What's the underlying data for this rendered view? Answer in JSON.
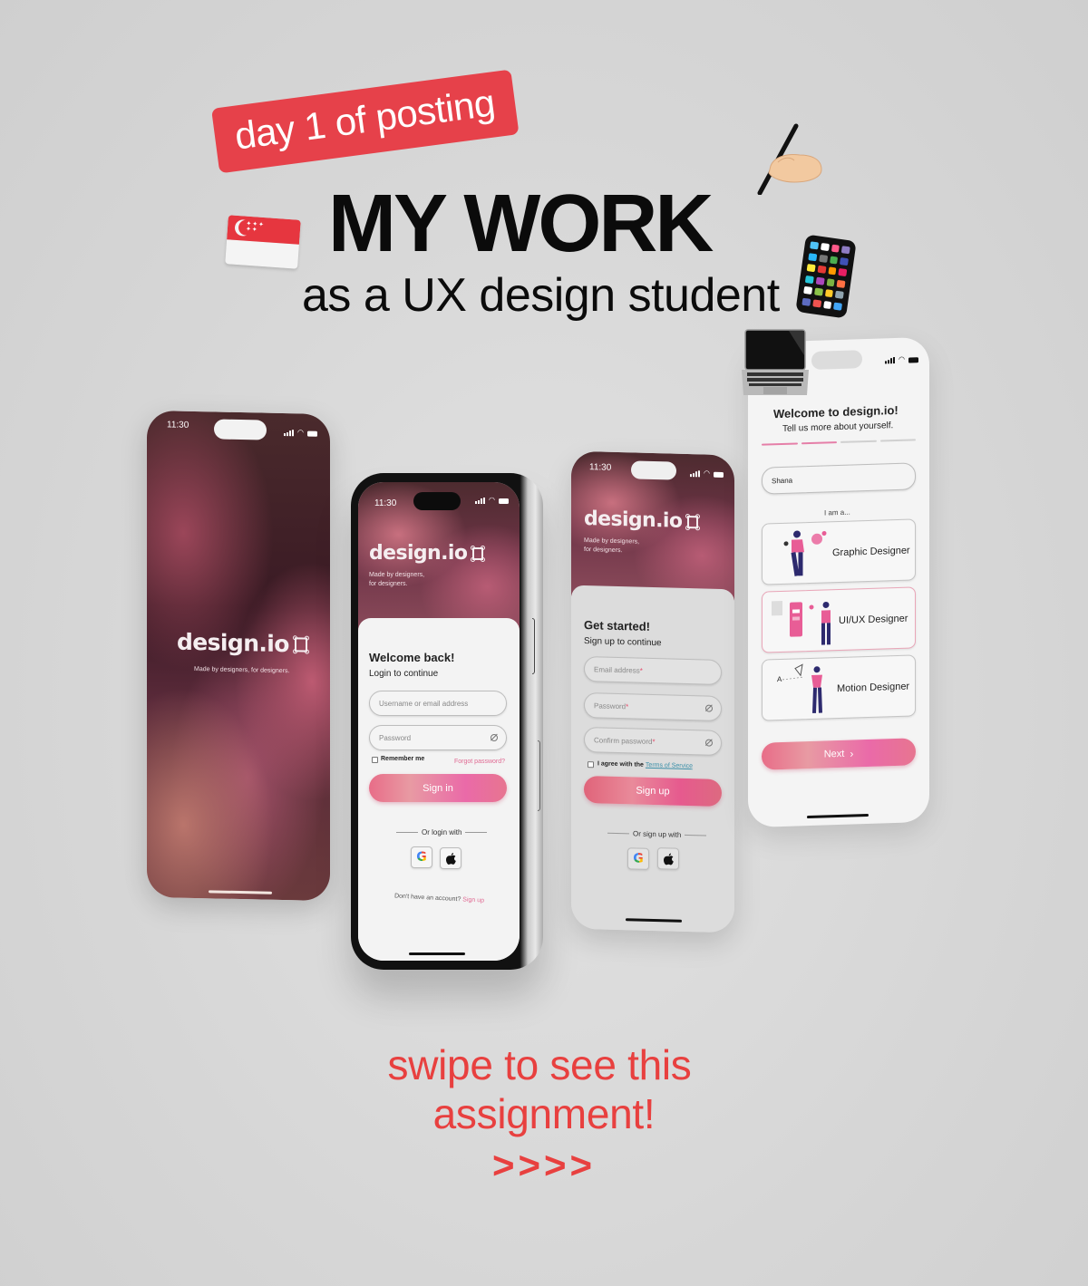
{
  "header": {
    "tag": "day 1 of posting",
    "title": "MY WORK",
    "subtitle": "as a UX design student"
  },
  "decorations": {
    "flag": "singapore-flag",
    "hand": "writing-hand",
    "phone": "mobile-phone",
    "laptop": "laptop"
  },
  "app": {
    "brand": "design.io",
    "tagline": "Made by designers, for designers.",
    "tagline_line1": "Made by designers,",
    "tagline_line2": "for designers.",
    "status_time": "11:30"
  },
  "splash_screen": {
    "time": "11:30",
    "brand": "design.io",
    "tagline": "Made by designers, for designers."
  },
  "login_screen": {
    "time": "11:30",
    "title": "Welcome back!",
    "subtitle": "Login to continue",
    "username_placeholder": "Username or email address",
    "password_placeholder": "Password",
    "remember_label": "Remember me",
    "forgot_label": "Forgot password?",
    "signin_label": "Sign in",
    "divider_label": "Or login with",
    "no_account_text": "Don't have an account?",
    "signup_link": "Sign up"
  },
  "signup_screen": {
    "time": "11:30",
    "title": "Get started!",
    "subtitle": "Sign up to continue",
    "email_placeholder": "Email address",
    "password_placeholder": "Password",
    "confirm_placeholder": "Confirm password",
    "required_mark": "*",
    "agree_text": "I agree with the",
    "terms_link": "Terms of Service",
    "signup_label": "Sign up",
    "divider_label": "Or sign up with"
  },
  "onboarding_screen": {
    "title": "Welcome to design.io!",
    "subtitle": "Tell us more about yourself.",
    "progress_steps_total": 4,
    "progress_steps_done": 2,
    "name_value": "Shana",
    "role_prompt": "I am a...",
    "roles": [
      {
        "label": "Graphic Designer",
        "selected": false
      },
      {
        "label": "UI/UX Designer",
        "selected": true
      },
      {
        "label": "Motion Designer",
        "selected": false
      }
    ],
    "next_label": "Next",
    "next_icon": "chevron-right"
  },
  "social": {
    "google": "G",
    "apple": ""
  },
  "footer": {
    "cta_line1": "swipe to see this",
    "cta_line2": "assignment!",
    "arrows": ">>>>"
  },
  "colors": {
    "accent_red": "#e6414a",
    "cta_red": "#e8403f",
    "pink": "#e86d88",
    "link_teal": "#3a8fa8"
  }
}
